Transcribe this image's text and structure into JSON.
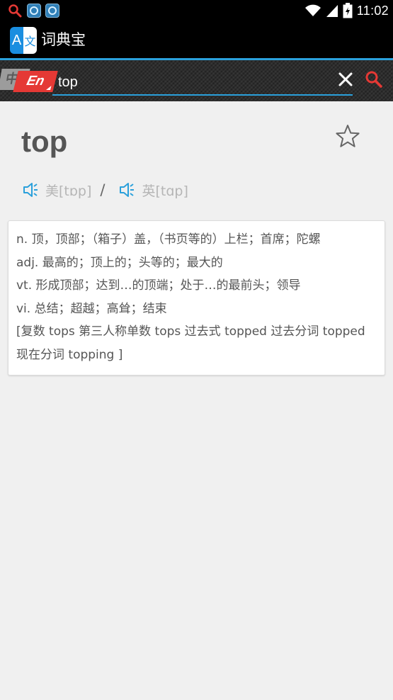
{
  "status_bar": {
    "time": "11:02",
    "icons": [
      "search-icon",
      "notification-icon",
      "notification-icon",
      "wifi-icon",
      "signal-icon",
      "battery-icon"
    ]
  },
  "app_bar": {
    "logo_letter": "A",
    "logo_char": "文",
    "title": "词典宝"
  },
  "search": {
    "lang_from": "中",
    "lang_to": "En",
    "query": "top",
    "accent_color": "#2aa0db",
    "search_icon_color": "#e53935"
  },
  "entry": {
    "word": "top",
    "pron_us": "美[tɒp]",
    "pron_uk": "英[tɑp]",
    "separator": "/",
    "definitions": [
      "n. 顶，顶部；（箱子）盖，（书页等的）上栏；首席；陀螺",
      "adj. 最高的；顶上的；头等的；最大的",
      "vt. 形成顶部；达到…的顶端；处于…的最前头；领导",
      "vi. 总结；超越；高耸；结束",
      "[复数 tops 第三人称单数 tops 过去式 topped 过去分词 topped",
      "现在分词 topping ]"
    ]
  }
}
